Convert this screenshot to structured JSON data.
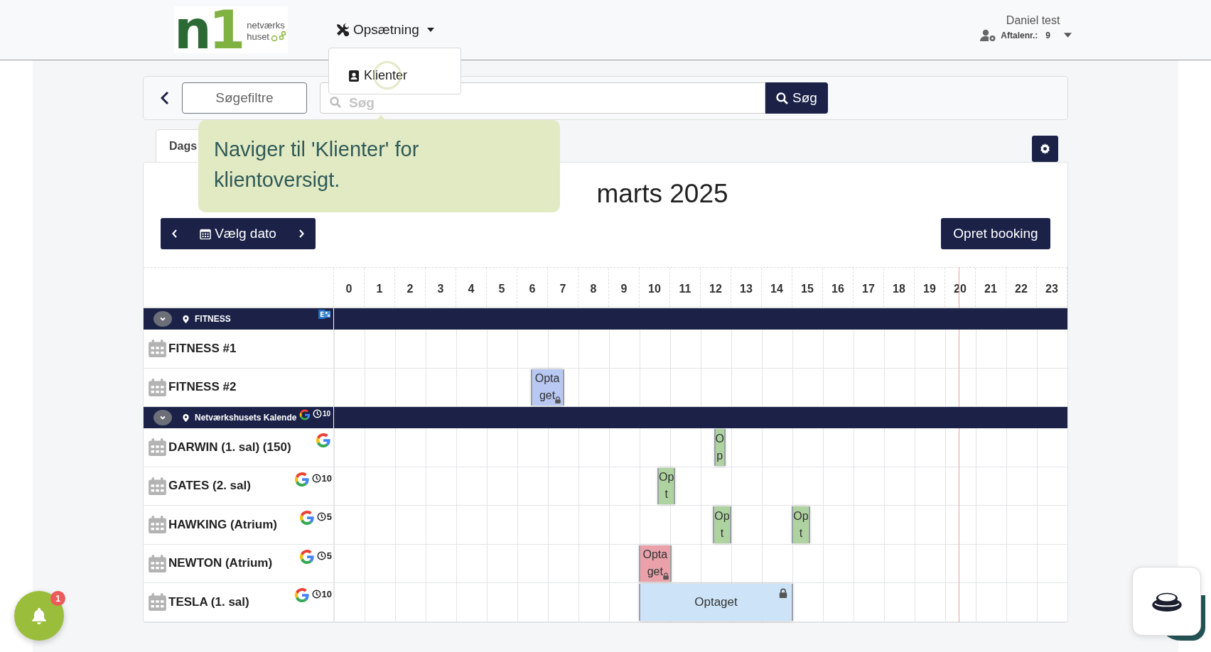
{
  "header": {
    "logo": {
      "mark": "n1",
      "line_1": "netværks",
      "line_2": "huset"
    },
    "menu": {
      "label": "Opsætning",
      "expanded": true,
      "items": [
        {
          "label": "Klienter",
          "highlighted": true
        }
      ]
    },
    "user": {
      "name": "Daniel test",
      "caption": "Aftalenr.:",
      "number": "9"
    }
  },
  "search_bar": {
    "filters_button": "Søgefiltre",
    "search": {
      "placeholder": "Søg"
    },
    "search_button": "Søg"
  },
  "tooltip": {
    "text": "Naviger til 'Klienter' for klientoversigt."
  },
  "tabs": [
    {
      "label": "Dags",
      "selected": true
    }
  ],
  "calendar": {
    "title": "marts 2025",
    "date_button": "Vælg dato",
    "create_button": "Opret booking",
    "hours": [
      "0",
      "1",
      "2",
      "3",
      "4",
      "5",
      "6",
      "7",
      "8",
      "9",
      "10",
      "11",
      "12",
      "13",
      "14",
      "15",
      "16",
      "17",
      "18",
      "19",
      "20",
      "21",
      "22",
      "23"
    ],
    "now_marker": {
      "level": 0.852
    },
    "groups": [
      {
        "name": "FITNESS",
        "expanded": true,
        "kind": "exchange",
        "resources": [
          {
            "name": "FITNESS #1",
            "kind": "plain"
          },
          {
            "name": "FITNESS #2",
            "kind": "plain",
            "bookings": [
              {
                "label": "Optaget",
                "start": {
                  "level": 0.269
                },
                "end": {
                  "level": 0.3125
                },
                "color": "#b8c8f2",
                "locked": true
              }
            ]
          }
        ]
      },
      {
        "name": "Netværkshusets Kalende",
        "expanded": true,
        "kind": "google",
        "buffer": "10",
        "resources": [
          {
            "name": "DARWIN (1. sal) (150)",
            "kind": "google",
            "bookings": [
              {
                "label": "Op",
                "start": {
                  "level": 0.519
                },
                "end": {
                  "level": 0.533
                },
                "color": "#aed3a0",
                "locked": false
              }
            ]
          },
          {
            "name": "GATES (2. sal)",
            "kind": "google",
            "buffer": "10",
            "bookings": [
              {
                "label": "Opt",
                "start": {
                  "level": 0.4417
                },
                "end": {
                  "level": 0.4646
                },
                "color": "#aed3a0",
                "locked": false
              }
            ]
          },
          {
            "name": "HAWKING (Atrium)",
            "kind": "google",
            "buffer": "5",
            "bookings": [
              {
                "label": "Opt",
                "start": {
                  "level": 0.5175
                },
                "end": {
                  "level": 0.5404
                },
                "color": "#aed3a0",
                "locked": false
              },
              {
                "label": "Opt",
                "start": {
                  "level": 0.625
                },
                "end": {
                  "level": 0.648
                },
                "color": "#aed3a0",
                "locked": false
              }
            ]
          },
          {
            "name": "NEWTON (Atrium)",
            "kind": "google",
            "buffer": "5",
            "bookings": [
              {
                "label": "Optaget",
                "start": {
                  "level": 0.4167
                },
                "end": {
                  "level": 0.459
                },
                "color": "#eba1aa",
                "locked": true
              }
            ]
          },
          {
            "name": "TESLA (1. sal)",
            "kind": "google",
            "buffer": "10",
            "bookings": [
              {
                "label": "Optaget",
                "start": {
                  "level": 0.4167
                },
                "end": {
                  "level": 0.625
                },
                "color": "#cde4f8",
                "locked": true
              }
            ]
          }
        ]
      }
    ]
  },
  "notifications": {
    "count": "1"
  }
}
